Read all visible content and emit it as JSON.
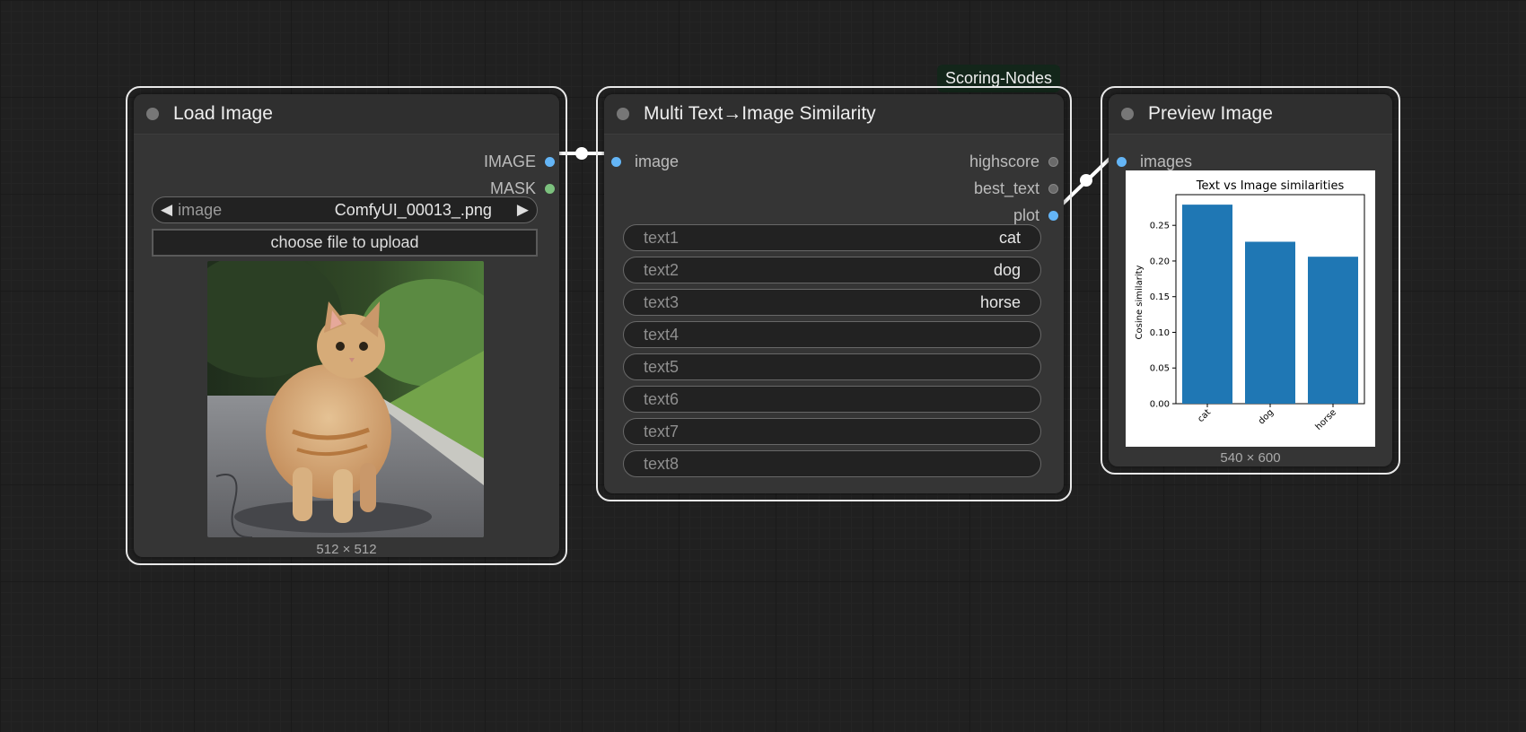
{
  "nodes": {
    "load_image": {
      "title": "Load Image",
      "outputs": [
        "IMAGE",
        "MASK"
      ],
      "image_widget": {
        "label": "image",
        "value": "ComfyUI_00013_.png",
        "prev": "◀",
        "next": "▶"
      },
      "upload_label": "choose file to upload",
      "size_caption": "512 × 512"
    },
    "similarity": {
      "title": "Multi Text→Image Similarity",
      "group_tag": "Scoring-Nodes",
      "input": "image",
      "outputs": [
        "highscore",
        "best_text",
        "plot"
      ],
      "texts": [
        {
          "label": "text1",
          "value": "cat"
        },
        {
          "label": "text2",
          "value": "dog"
        },
        {
          "label": "text3",
          "value": "horse"
        },
        {
          "label": "text4",
          "value": ""
        },
        {
          "label": "text5",
          "value": ""
        },
        {
          "label": "text6",
          "value": ""
        },
        {
          "label": "text7",
          "value": ""
        },
        {
          "label": "text8",
          "value": ""
        }
      ]
    },
    "preview": {
      "title": "Preview Image",
      "input": "images",
      "size_caption": "540 × 600"
    }
  },
  "colors": {
    "image_slot": "#64b5f6",
    "mask_slot": "#7cc17e",
    "bar": "#1f77b4",
    "group_tag_bg": "#13261a"
  },
  "chart_data": {
    "type": "bar",
    "title": "Text vs Image similarities",
    "ylabel": "Cosine similarity",
    "xlabel": "",
    "categories": [
      "cat",
      "dog",
      "horse"
    ],
    "values": [
      0.279,
      0.227,
      0.206
    ],
    "ylim": [
      0,
      0.293
    ],
    "yticks": [
      "0.00",
      "0.05",
      "0.10",
      "0.15",
      "0.20",
      "0.25"
    ],
    "grid": false
  }
}
